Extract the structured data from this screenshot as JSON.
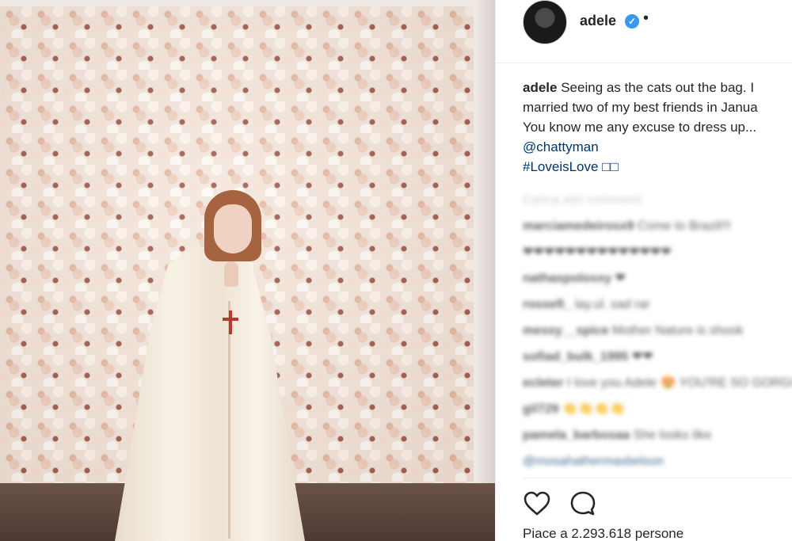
{
  "post": {
    "username": "adele",
    "verified_mark": "✓",
    "separator": "•",
    "caption_user": "adele",
    "caption_lines": [
      "Seeing as the cats out the bag. I",
      "married two of my best friends in Janua",
      "You know me any excuse to dress up..."
    ],
    "mention": "@chattyman",
    "hashtag": "#LoveisLove □□"
  },
  "comments": {
    "load_more": "Carica altri commenti",
    "items": [
      {
        "user": "marciamedeirosx9",
        "text": "Come to Brazil!!!"
      },
      {
        "user": "",
        "text": "❤❤❤❤❤❤❤❤❤❤❤❤❤❤"
      },
      {
        "user": "nathaspolosxy",
        "text": "❤"
      },
      {
        "user": "rossefi_",
        "text": "lay.ul. sad rar"
      },
      {
        "user": "messy__spice",
        "text": "Mother Nature is shook"
      },
      {
        "user": "sofiad_bulk_1995",
        "text": "❤❤"
      },
      {
        "user": "ecleter",
        "text": "I love you Adele 😍 YOU'RE SO GORGEOUS 😍"
      },
      {
        "user": "gil729",
        "text": "👏👏👏👏"
      },
      {
        "user": "pamela_barbosaa",
        "text": "She looks like"
      },
      {
        "user": "",
        "text": "@mosahathermaxbelson"
      }
    ]
  },
  "actions": {
    "like_icon": "heart-outline",
    "comment_icon": "comment-bubble"
  },
  "likes": {
    "text": "Piace a 2.293.618 persone"
  },
  "photo": {
    "subject": "photo"
  }
}
